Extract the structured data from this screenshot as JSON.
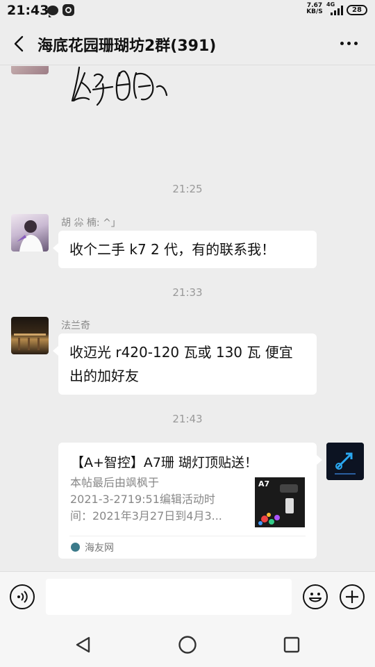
{
  "status_bar": {
    "time": "21:43",
    "speed_value": "7.67",
    "speed_unit": "KB/S",
    "network": "4G",
    "battery": "28"
  },
  "header": {
    "title": "海底花园珊瑚坊2群(391)",
    "back_icon": "back-arrow-icon",
    "more_icon": "more-dots-icon"
  },
  "messages": [
    {
      "type": "image-handwriting",
      "content": "handwritten greeting image"
    },
    {
      "type": "time",
      "text": "21:25"
    },
    {
      "type": "text",
      "sender": "胡 尛 楠: ^」",
      "text": "收个二手 k7  2 代，有的联系我！"
    },
    {
      "type": "time",
      "text": "21:33"
    },
    {
      "type": "text",
      "sender": "法兰奇",
      "lines": [
        "收迈光 r420-120 瓦或 130 瓦  便宜",
        "出的加好友"
      ]
    },
    {
      "type": "time",
      "text": "21:43"
    },
    {
      "type": "link-card",
      "title": "【A+智控】A7珊 瑚灯顶贴送！",
      "desc_lines": [
        "本帖最后由飒枫于",
        "2021-3-2719:51编辑活动时",
        "间：2021年3月27日到4月3..."
      ],
      "thumb_label": "A7",
      "source": "海友网"
    }
  ],
  "input_bar": {
    "voice_icon": "voice-icon",
    "emoji_icon": "emoji-icon",
    "add_icon": "plus-icon",
    "message_value": ""
  },
  "nav_bar": {
    "back": "nav-back-icon",
    "home": "nav-home-icon",
    "recents": "nav-recents-icon"
  },
  "colors": {
    "background": "#ededed",
    "bubble": "#ffffff",
    "meta_text": "#999999"
  }
}
